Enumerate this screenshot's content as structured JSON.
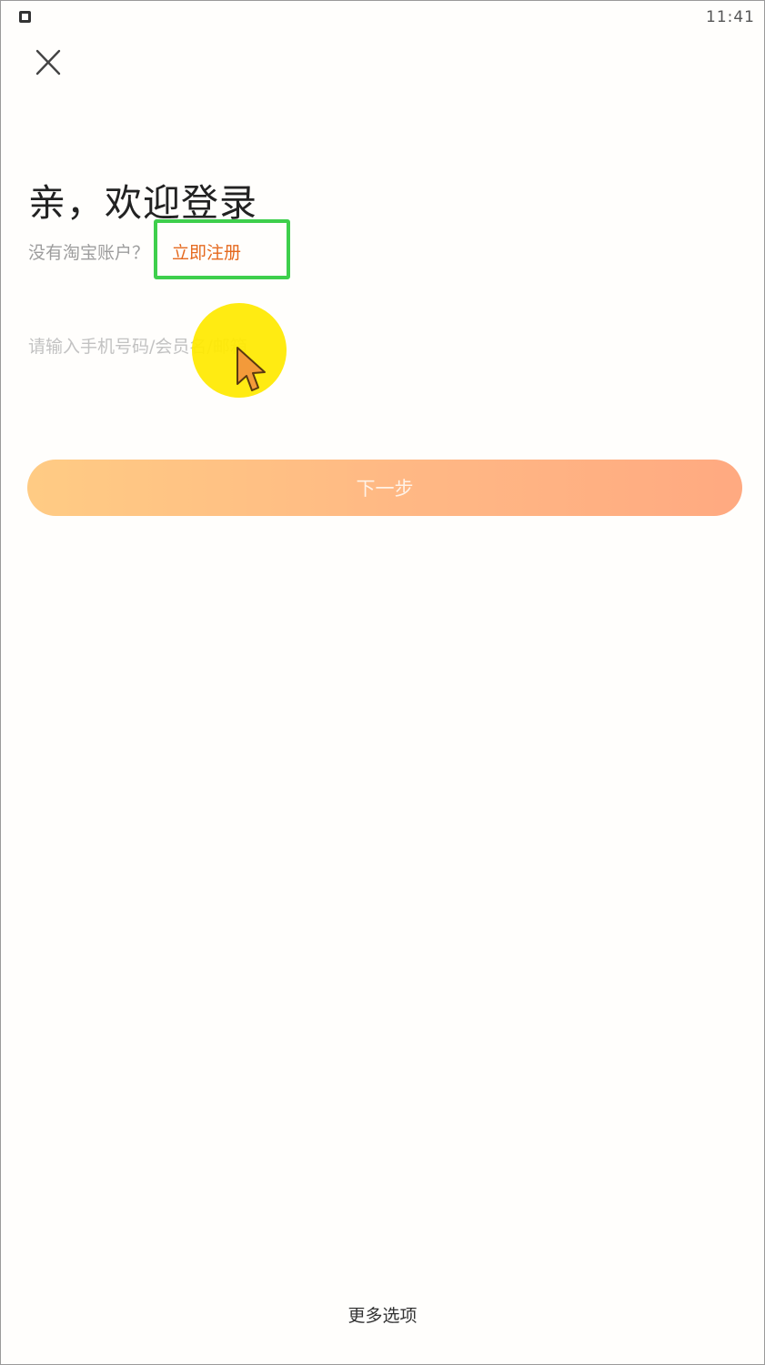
{
  "status_bar": {
    "time": "11:41",
    "left_icon": "notification-square-icon"
  },
  "header": {
    "close_icon": "close-icon"
  },
  "login": {
    "title": "亲，欢迎登录",
    "no_account_text": "没有淘宝账户？",
    "register_label": "立即注册",
    "account_placeholder": "请输入手机号码/会员名/邮箱",
    "account_value": "",
    "next_button_label": "下一步"
  },
  "footer": {
    "more_options_label": "更多选项"
  },
  "colors": {
    "accent_orange": "#e5691e",
    "button_gradient_start": "#ffc77a",
    "button_gradient_end": "#ffa276",
    "highlight_green": "#3ecf4c",
    "cursor_highlight_yellow": "#ffe900"
  }
}
